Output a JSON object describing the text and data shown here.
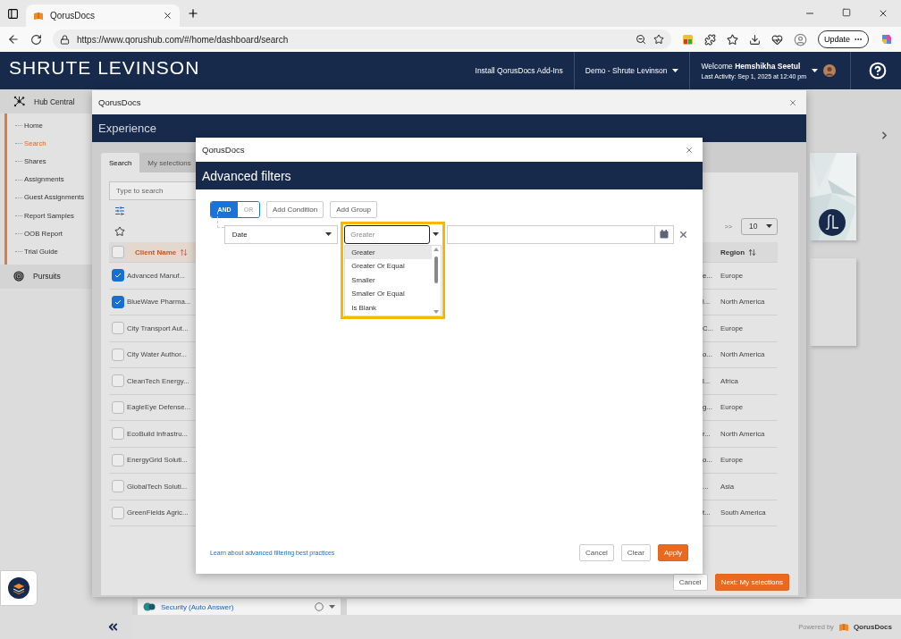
{
  "browser": {
    "tab_title": "QorusDocs",
    "url": "https://www.qorushub.com/#/home/dashboard/search",
    "update_button": "Update"
  },
  "header": {
    "logo": "SHRUTE LEVINSON",
    "install_link": "Install QorusDocs Add-Ins",
    "workspace": "Demo - Shrute Levinson",
    "welcome": "Welcome",
    "user": "Hemshikha Seetul",
    "last_activity": "Last Activity: Sep 1, 2025 at 12:40 pm"
  },
  "sidebar": [
    {
      "kind": "hub",
      "label": "Hub Central",
      "children": [
        {
          "label": "Home",
          "selected": false
        },
        {
          "label": "Search",
          "selected": true
        },
        {
          "label": "Shares",
          "selected": false
        },
        {
          "label": "Assignments",
          "selected": false
        },
        {
          "label": "Guest Assignments",
          "selected": false
        },
        {
          "label": "Report Samples",
          "selected": false
        },
        {
          "label": "OOB Report",
          "selected": false
        },
        {
          "label": "Trial Guide",
          "selected": false
        }
      ]
    },
    {
      "kind": "target",
      "label": "Pursuits"
    }
  ],
  "background": {
    "security_item": "Security (Auto Answer)",
    "powered_by": "Powered by",
    "powered_brand": "QorusDocs"
  },
  "experience_dialog": {
    "title": "QorusDocs",
    "heading": "Experience",
    "tabs": [
      {
        "label": "Search",
        "selected": true
      },
      {
        "label": "My selections",
        "selected": false
      }
    ],
    "search": {
      "placeholder": "Type to search"
    },
    "pager": ">>",
    "page_size": "10",
    "table": {
      "all_checked": false,
      "columns": [
        "Client Name",
        "Region"
      ],
      "rows": [
        {
          "checked": true,
          "client": "Advanced Manuf...",
          "column_3": "e...",
          "region": "Europe"
        },
        {
          "checked": true,
          "client": "BlueWave Pharma...",
          "column_3": "l...",
          "region": "North America"
        },
        {
          "checked": false,
          "client": "City Transport Aut...",
          "column_3": "C...",
          "region": "Europe"
        },
        {
          "checked": false,
          "client": "City Water Author...",
          "column_3": "o...",
          "region": "North America"
        },
        {
          "checked": false,
          "client": "CleanTech Energy...",
          "column_3": "l...",
          "region": "Africa"
        },
        {
          "checked": false,
          "client": "EagleEye Defense...",
          "column_3": "g...",
          "region": "Europe"
        },
        {
          "checked": false,
          "client": "EcoBuild Infrastru...",
          "column_3": "r...",
          "region": "North America"
        },
        {
          "checked": false,
          "client": "EnergyGrid Soluti...",
          "column_3": "o...",
          "region": "Europe"
        },
        {
          "checked": false,
          "client": "GlobalTech Soluti...",
          "column_3": "...",
          "region": "Asia"
        },
        {
          "checked": false,
          "client": "GreenFields Agric...",
          "column_3": "t...",
          "region": "South America"
        }
      ]
    },
    "buttons": [
      {
        "label": "Cancel",
        "kind": "plain"
      },
      {
        "label": "Next: My selections",
        "kind": "primary"
      }
    ]
  },
  "filters_dialog": {
    "title": "QorusDocs",
    "heading": "Advanced filters",
    "logic": [
      {
        "label": "AND",
        "selected": true
      },
      {
        "label": "OR",
        "selected": false
      }
    ],
    "actions": [
      "Add Condition",
      "Add Group"
    ],
    "condition": {
      "field": "Date",
      "operator": {
        "placeholder": "Greater",
        "options": [
          {
            "label": "Greater",
            "selected": true
          },
          {
            "label": "Greater Or Equal",
            "selected": false
          },
          {
            "label": "Smaller",
            "selected": false
          },
          {
            "label": "Smaller Or Equal",
            "selected": false
          },
          {
            "label": "Is Blank",
            "selected": false
          }
        ]
      }
    },
    "help_link": "Learn about advanced filtering best practices",
    "buttons": [
      {
        "label": "Cancel",
        "kind": "plain"
      },
      {
        "label": "Clear",
        "kind": "plain"
      },
      {
        "label": "Apply",
        "kind": "primary"
      }
    ]
  }
}
